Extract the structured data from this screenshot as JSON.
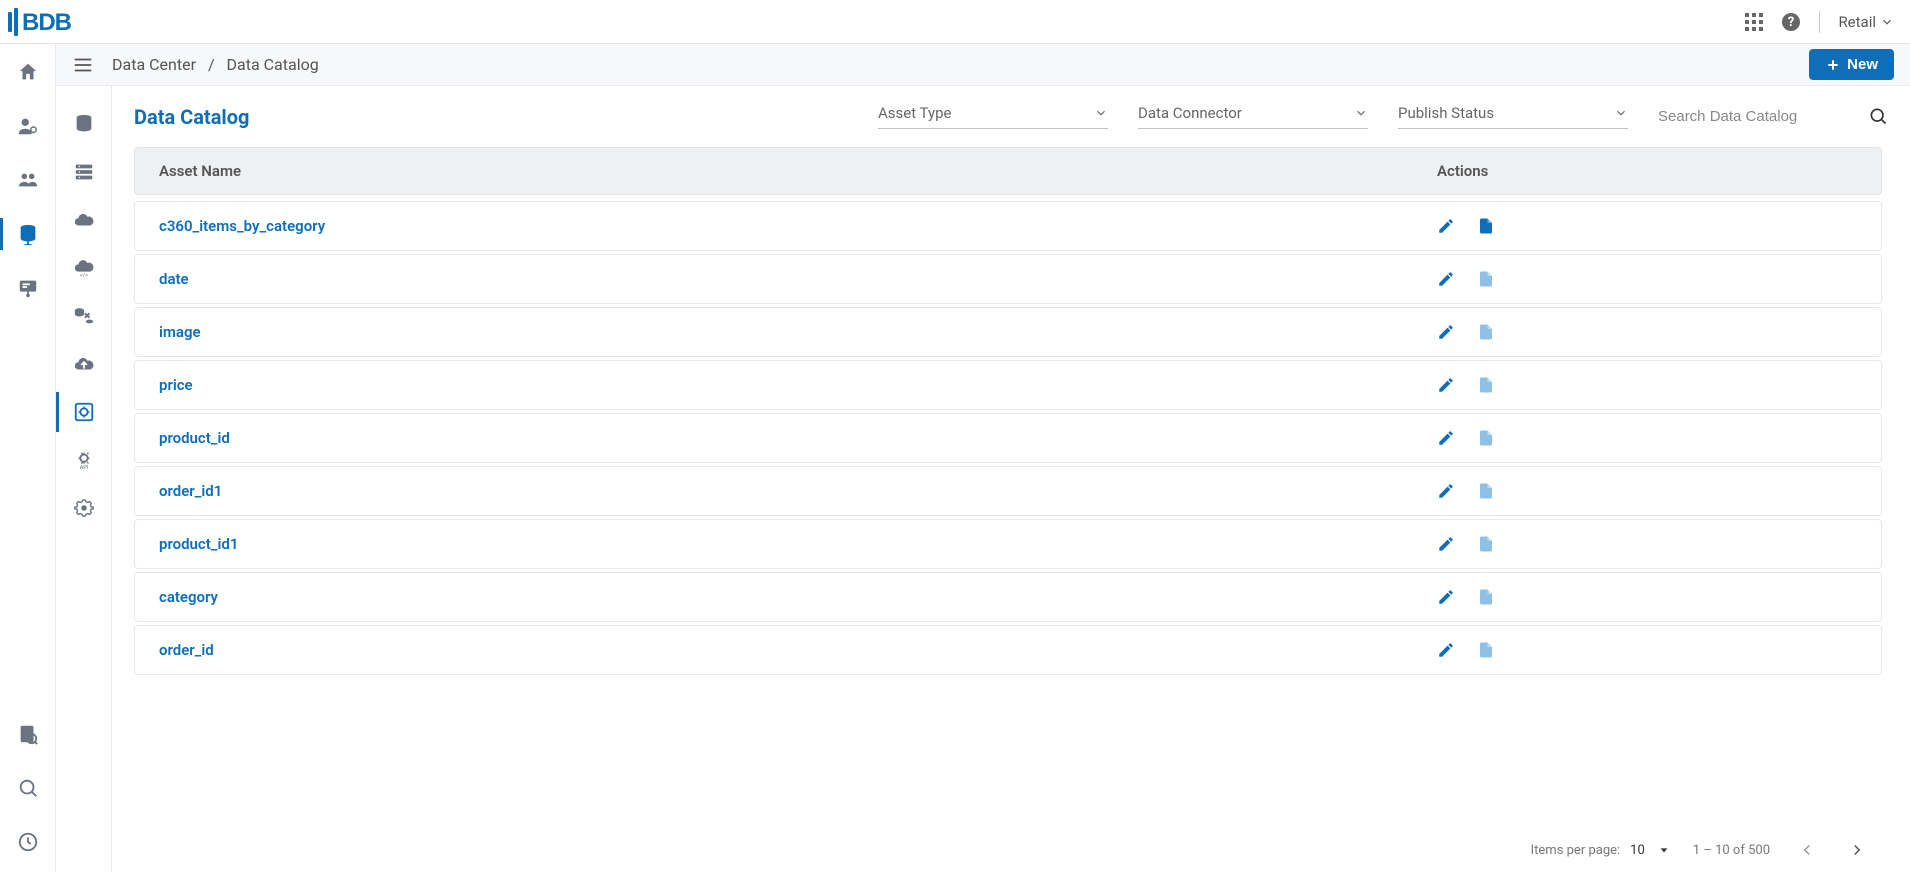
{
  "header": {
    "tenant": "Retail"
  },
  "left_rail": [
    {
      "name": "home-icon",
      "label": "Home"
    },
    {
      "name": "user-admin-icon",
      "label": "User Admin"
    },
    {
      "name": "groups-icon",
      "label": "Groups"
    },
    {
      "name": "data-icon",
      "label": "Data",
      "active": true
    },
    {
      "name": "presentation-icon",
      "label": "Presentation"
    }
  ],
  "left_rail_bottom": [
    {
      "name": "audit-icon",
      "label": "Audit"
    },
    {
      "name": "explore-icon",
      "label": "Explore"
    },
    {
      "name": "monitor-icon",
      "label": "Monitor"
    }
  ],
  "sec_rail": [
    {
      "name": "data-home-icon",
      "label": "Data Home"
    },
    {
      "name": "data-stores-icon",
      "label": "Data Stores"
    },
    {
      "name": "servers-icon",
      "label": "Servers"
    },
    {
      "name": "cloud-icon",
      "label": "Cloud"
    },
    {
      "name": "cloud-code-icon",
      "label": "Cloud Code"
    },
    {
      "name": "transform-icon",
      "label": "Transform"
    },
    {
      "name": "upload-cloud-icon",
      "label": "Upload"
    },
    {
      "name": "catalog-icon",
      "label": "Data Catalog",
      "active": true
    },
    {
      "name": "api-settings-icon",
      "label": "API Settings"
    },
    {
      "name": "settings-gear-icon",
      "label": "Settings"
    }
  ],
  "breadcrumb": {
    "parent": "Data Center",
    "current": "Data Catalog"
  },
  "new_button": "New",
  "page_title": "Data Catalog",
  "filters": {
    "asset_type": "Asset Type",
    "data_connector": "Data Connector",
    "publish_status": "Publish Status"
  },
  "search": {
    "placeholder": "Search Data Catalog"
  },
  "table": {
    "headers": {
      "name": "Asset Name",
      "actions": "Actions"
    },
    "rows": [
      {
        "name": "c360_items_by_category",
        "doc_muted": false
      },
      {
        "name": "date",
        "doc_muted": true
      },
      {
        "name": "image",
        "doc_muted": true
      },
      {
        "name": "price",
        "doc_muted": true
      },
      {
        "name": "product_id",
        "doc_muted": true
      },
      {
        "name": "order_id1",
        "doc_muted": true
      },
      {
        "name": "product_id1",
        "doc_muted": true
      },
      {
        "name": "category",
        "doc_muted": true
      },
      {
        "name": "order_id",
        "doc_muted": true
      }
    ]
  },
  "paginator": {
    "label": "Items per page:",
    "size": "10",
    "range": "1 – 10 of 500"
  }
}
